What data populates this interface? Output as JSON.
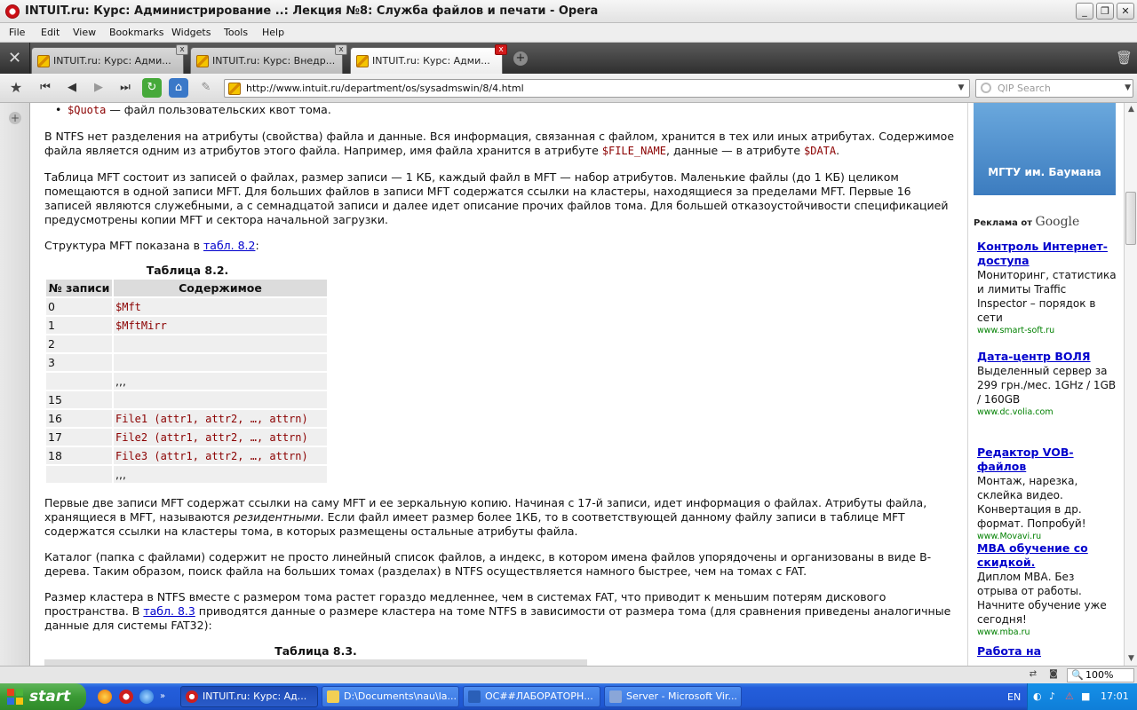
{
  "window": {
    "title": "INTUIT.ru: Курс: Администрирование ..: Лекция №8: Служба файлов и печати - Opera",
    "min": "_",
    "max": "❐",
    "close": "✕"
  },
  "menu": [
    "File",
    "Edit",
    "View",
    "Bookmarks",
    "Widgets",
    "Tools",
    "Help"
  ],
  "tabs": [
    {
      "label": "INTUIT.ru: Курс: Адми..."
    },
    {
      "label": "INTUIT.ru: Курс: Внедр..."
    },
    {
      "label": "INTUIT.ru: Курс: Адми..."
    }
  ],
  "tab_close": "x",
  "newtab": "+",
  "nav": {
    "url": "http://www.intuit.ru/department/os/sysadmswin/8/4.html",
    "search_placeholder": "QIP Search",
    "drop": "▼"
  },
  "article": {
    "bullet_code": "$Quota",
    "bullet_text": " — файл пользовательских квот тома.",
    "p1_a": "В NTFS нет разделения на атрибуты (свойства) файла и данные. Вся информация, связанная с файлом, хранится в тех или иных атрибутах. Содержимое файла является одним из атрибутов этого файла. Например, имя файла хранится в атрибуте ",
    "p1_code1": "$FILE_NAME",
    "p1_b": ", данные — в атрибуте ",
    "p1_code2": "$DATA",
    "p1_c": ".",
    "p2": "Таблица MFT состоит из записей о файлах, размер записи — 1 КБ, каждый файл в MFT — набор атрибутов. Маленькие файлы (до 1 КБ) целиком помещаются в одной записи MFT. Для больших файлов в записи MFT содержатся ссылки на кластеры, находящиеся за пределами MFT. Первые 16 записей являются служебными, а с семнадцатой записи и далее идет описание прочих файлов тома. Для большей отказоустойчивости спецификацией предусмотрены копии MFT и сектора начальной загрузки.",
    "p3_a": "Структура MFT показана в ",
    "p3_link": "табл. 8.2",
    "p3_b": ":",
    "table82_caption": "Таблица 8.2.",
    "table82_headers": [
      "№ записи",
      "Содержимое"
    ],
    "table82_rows": [
      [
        "0",
        "$Mft"
      ],
      [
        "1",
        "$MftMirr"
      ],
      [
        "2",
        ""
      ],
      [
        "3",
        ""
      ],
      [
        "",
        ",,,"
      ],
      [
        "15",
        ""
      ],
      [
        "16",
        "File1 (attr1, attr2, …, attrn)"
      ],
      [
        "17",
        "File2 (attr1, attr2, …, attrn)"
      ],
      [
        "18",
        "File3 (attr1, attr2, …, attrn)"
      ],
      [
        "",
        ",,,"
      ]
    ],
    "p4_a": "Первые две записи MFT содержат ссылки на саму MFT и ее зеркальную копию. Начиная с 17-й записи, идет информация о файлах. Атрибуты файла, хранящиеся в MFT, называются ",
    "p4_em": "резидентными",
    "p4_b": ". Если файл имеет размер более 1КБ, то в соответствующей данному файлу записи в таблице MFT содержатся ссылки на кластеры тома, в которых размещены остальные атрибуты файла.",
    "p5": "Каталог (папка с файлами) содержит не просто линейный список файлов, а индекс, в котором имена файлов упорядочены и организованы в виде B-дерева. Таким образом, поиск файла на больших томах (разделах) в NTFS осуществляется намного быстрее, чем на томах с FAT.",
    "p6_a": "Размер кластера в NTFS вместе с размером тома растет гораздо медленнее, чем в системах FAT, что приводит к меньшим потерям дискового пространства. В ",
    "p6_link": "табл. 8.3",
    "p6_b": " приводятся данные о размере кластера на томе NTFS в зависимости от размера тома (для сравнения приведены аналогичные данные для системы FAT32):",
    "table83_caption": "Таблица 8.3."
  },
  "ads": {
    "banner": "МГТУ им. Баумана",
    "label": "Реклама от ",
    "google": "Google",
    "items": [
      {
        "title": "Контроль Интернет-доступа",
        "text": "Мониторинг, статистика и лимиты Traffic Inspector – порядок в сети",
        "url": "www.smart-soft.ru"
      },
      {
        "title": "Дата-центр ВОЛЯ",
        "text": "Выделенный сервер за 299 грн./мес. 1GHz / 1GB / 160GB",
        "url": "www.dc.volia.com"
      },
      {
        "title": "Редактор VOB-файлов",
        "text": "Монтаж, нарезка, склейка видео. Конвертация в др. формат. Попробуй!",
        "url": "www.Movavi.ru"
      },
      {
        "title": "MBA обучение со скидкой.",
        "text": "Диплом МВА. Без отрыва от работы. Начните обучение уже сегодня!",
        "url": "www.mba.ru"
      },
      {
        "title": "Работа на",
        "text": "",
        "url": ""
      }
    ]
  },
  "status": {
    "zoom": "100%"
  },
  "taskbar": {
    "start": "start",
    "tasks": [
      {
        "label": "INTUIT.ru: Курс: Ад...",
        "icon_color": "#cc1f1f"
      },
      {
        "label": "D:\\Documents\\nau\\la...",
        "icon_color": "#f2cf54"
      },
      {
        "label": "ОС##ЛАБОРАТОРН...",
        "icon_color": "#2a5fb8"
      },
      {
        "label": "Server - Microsoft Vir...",
        "icon_color": "#8aa6d8"
      }
    ],
    "lang": "EN",
    "clock": "17:01"
  }
}
